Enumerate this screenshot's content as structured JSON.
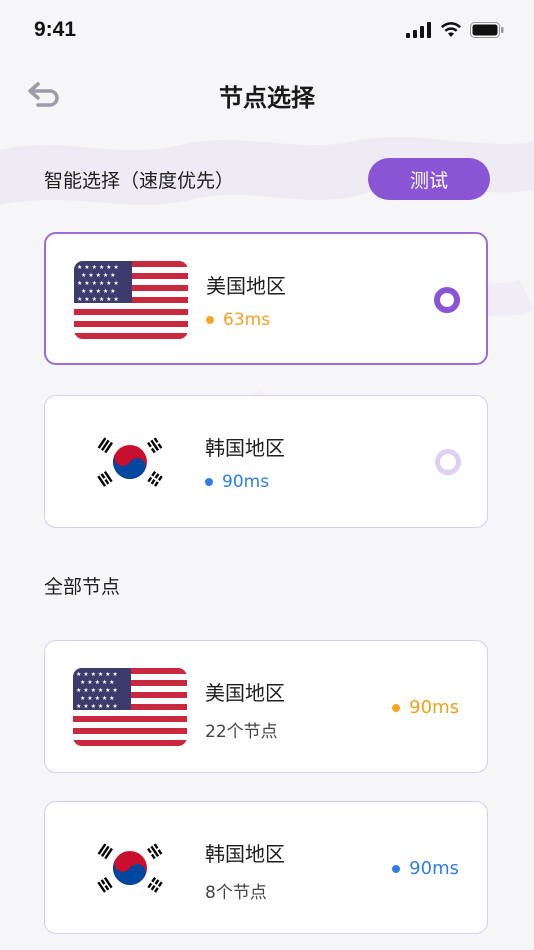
{
  "status": {
    "time": "9:41"
  },
  "nav": {
    "title": "节点选择"
  },
  "smart": {
    "title": "智能选择（速度优先）",
    "test_label": "测试",
    "items": [
      {
        "name": "美国地区",
        "latency": "63ms",
        "flag": "us-flag",
        "selected": true
      },
      {
        "name": "韩国地区",
        "latency": "90ms",
        "flag": "kr-flag",
        "selected": false
      }
    ]
  },
  "all": {
    "title": "全部节点",
    "items": [
      {
        "name": "美国地区",
        "nodes": "22个节点",
        "latency": "90ms",
        "flag": "us-flag"
      },
      {
        "name": "韩国地区",
        "nodes": "8个节点",
        "latency": "90ms",
        "flag": "kr-flag"
      }
    ]
  },
  "colors": {
    "accent": "#8a55d4",
    "latency_orange": "#f0a21e",
    "latency_blue": "#2d7fe3"
  }
}
